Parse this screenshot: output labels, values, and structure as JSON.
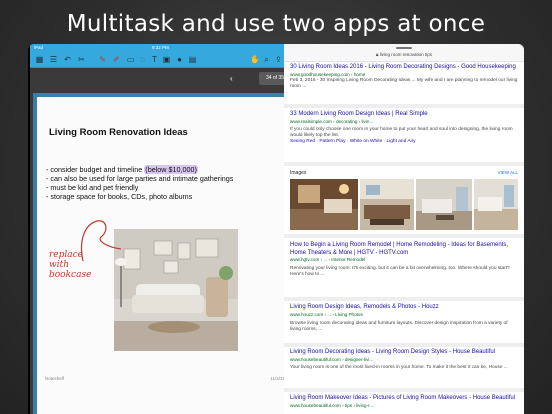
{
  "headline": "Multitask and use two apps at once",
  "status": {
    "carrier": "iPad",
    "time": "9:32 PM",
    "battery": "39%"
  },
  "toolbar_icons": [
    "grid-icon",
    "list-icon",
    "undo-icon",
    "scissors-icon",
    "pen-icon",
    "marker-icon",
    "eraser-icon",
    "lasso-icon",
    "text-icon",
    "image-icon",
    "mic-icon",
    "doc-icon",
    "hand-icon",
    "search-icon",
    "share-icon",
    "gear-icon"
  ],
  "pager": {
    "label": "34 of 35",
    "prev": "‹",
    "next": "›"
  },
  "note": {
    "title": "Living Room Renovation Ideas",
    "bullets": [
      {
        "text": "- consider budget and timeline ",
        "highlight": "(below $10,000)"
      },
      {
        "text": "- can also be used for large parties and intimate gatherings",
        "highlight": ""
      },
      {
        "text": "- must be kid and pet friendly",
        "highlight": ""
      },
      {
        "text": "- storage space for books, CDs, photo albums",
        "highlight": ""
      }
    ],
    "handwriting": [
      "replace",
      "with",
      "bookcase"
    ],
    "footer": "Noteshelf",
    "date": "11/4/15"
  },
  "browser": {
    "url": "living room renovation tips",
    "results_top": [
      {
        "title": "30 Living Room Ideas 2016 - Living Room Decorating Designs - Good Housekeeping",
        "url": "www.goodhousekeeping.com › home",
        "snippet": "Feb 3, 2016 - 30 Inspiring Living Room Decorating Ideas ... My wife and I are planning to remodel our living room ..."
      },
      {
        "title": "33 Modern Living Room Design Ideas | Real Simple",
        "url": "www.realsimple.com › decorating › livin...",
        "snippet": "If you could only choose one room in your home to put your heart and soul into designing, the living room would likely top the list.",
        "links": "Seeing Red · Pattern Play · White on White · Light and Airy"
      }
    ],
    "images_label": "Images",
    "view_all": "VIEW ALL",
    "results_bottom": [
      {
        "title": "How to Begin a Living Room Remodel | Home Remodeling - Ideas for Basements, Home Theaters & More | HGTV - HGTV.com",
        "url": "www.hgtv.com › ... › Interior Remodel",
        "snippet": "Renovating your living room: It's exciting, but it can be a bit overwhelming, too. Where should you start? Here's how to ..."
      },
      {
        "title": "Living Room Design Ideas, Remodels & Photos - Houzz",
        "url": "www.houzz.com › ... › Living Photos",
        "snippet": "Browse living room decorating ideas and furniture layouts. Discover design inspiration from a variety of living rooms, ..."
      },
      {
        "title": "Living Room Decorating Ideas - Living Room Design Styles - House Beautiful",
        "url": "www.housebeautiful.com › designer-livi...",
        "snippet": "Your living room is one of the most lived-in rooms in your home. To make it the best it can be, House ..."
      },
      {
        "title": "Living Room Makeover Ideas - Pictures of Living Room Makeovers - House Beautiful",
        "url": "www.housebeautiful.com › tips › living-r..."
      }
    ]
  }
}
